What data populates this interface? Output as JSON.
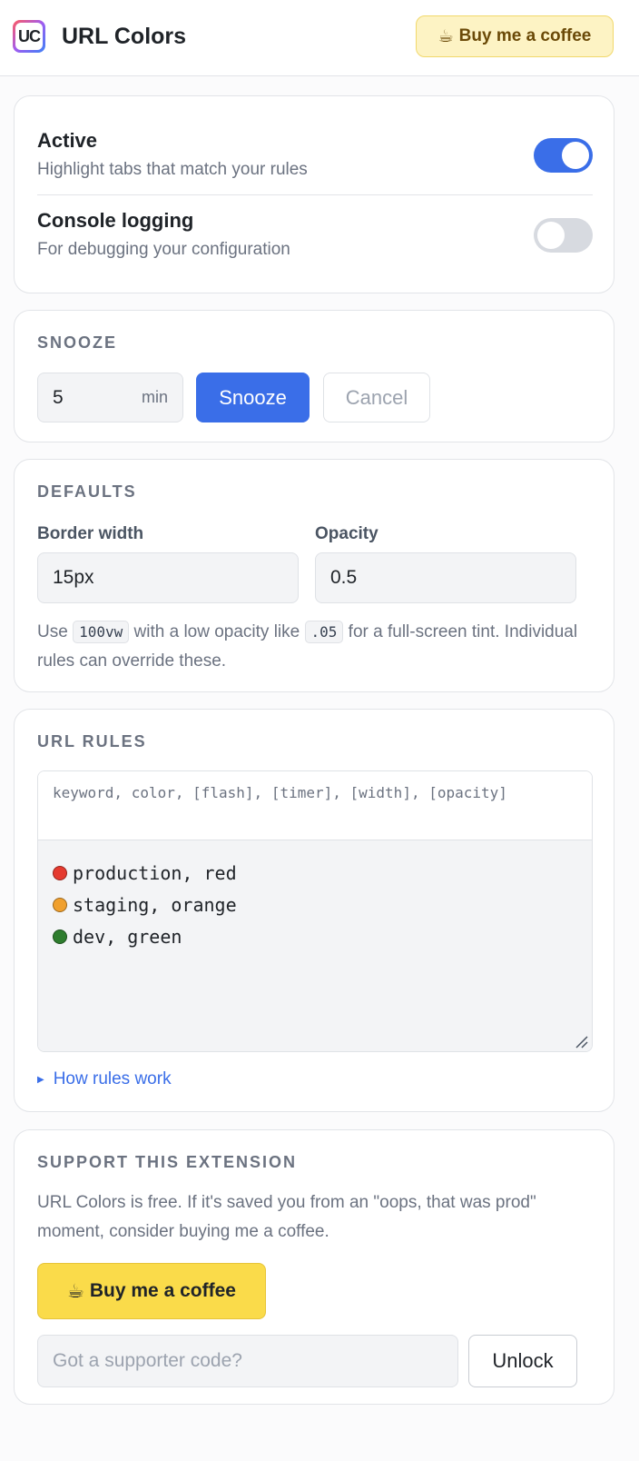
{
  "header": {
    "logo_text": "UC",
    "title": "URL Colors",
    "coffee_emoji": "☕",
    "coffee_label": "Buy me a coffee"
  },
  "toggles": [
    {
      "title": "Active",
      "subtitle": "Highlight tabs that match your rules",
      "on": true
    },
    {
      "title": "Console logging",
      "subtitle": "For debugging your configuration",
      "on": false
    }
  ],
  "snooze": {
    "heading": "SNOOZE",
    "minutes_value": "5",
    "unit": "min",
    "snooze_label": "Snooze",
    "cancel_label": "Cancel"
  },
  "defaults": {
    "heading": "DEFAULTS",
    "border_width_label": "Border width",
    "border_width_value": "15px",
    "opacity_label": "Opacity",
    "opacity_value": "0.5",
    "hint_prefix": "Use ",
    "hint_code_1": "100vw",
    "hint_mid": " with a low opacity like ",
    "hint_code_2": ".05",
    "hint_suffix": " for a full-screen tint. Individual rules can override these."
  },
  "rules": {
    "heading": "URL RULES",
    "format_hint": "keyword, color, [flash], [timer], [width], [opacity]",
    "items": [
      {
        "text": "production, red",
        "color": "#e53a2f"
      },
      {
        "text": "staging, orange",
        "color": "#f0a02e"
      },
      {
        "text": "dev, green",
        "color": "#2e7d2e"
      }
    ],
    "how_link": "How rules work"
  },
  "support": {
    "heading": "SUPPORT THIS EXTENSION",
    "text": "URL Colors is free. If it's saved you from an \"oops, that was prod\" moment, consider buying me a coffee.",
    "coffee_emoji": "☕",
    "coffee_label": "Buy me a coffee",
    "code_placeholder": "Got a supporter code?",
    "unlock_label": "Unlock"
  },
  "colors": {
    "accent": "#3a6ee8",
    "coffee_yellow": "#fadb4a",
    "coffee_light": "#fdf3c4"
  }
}
